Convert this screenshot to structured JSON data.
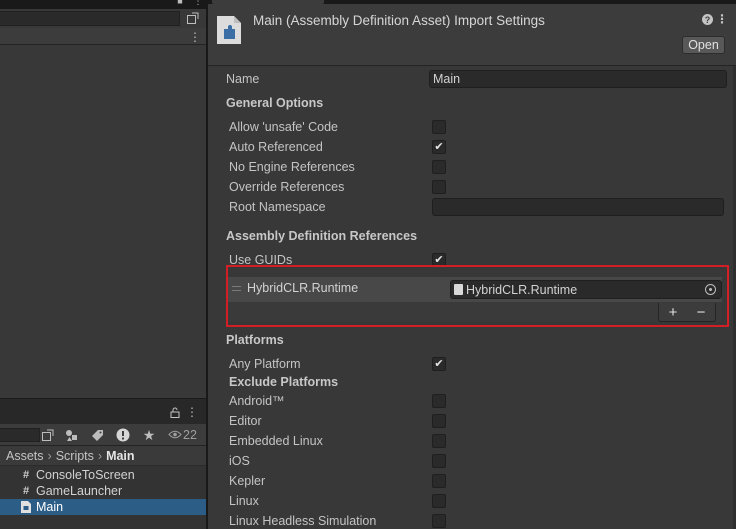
{
  "project": {
    "eye_count": "22",
    "breadcrumb": [
      "Assets",
      "Scripts",
      "Main"
    ],
    "files": [
      {
        "name": "ConsoleToScreen",
        "icon": "csharp-icon",
        "selected": false
      },
      {
        "name": "GameLauncher",
        "icon": "csharp-icon",
        "selected": false
      },
      {
        "name": "Main",
        "icon": "assembly-definition-icon",
        "selected": true
      }
    ]
  },
  "inspector": {
    "title": "Main (Assembly Definition Asset) Import Settings",
    "open_label": "Open",
    "name_label": "Name",
    "name_value": "Main",
    "general_options": {
      "heading": "General Options",
      "allow_unsafe_label": "Allow 'unsafe' Code",
      "allow_unsafe": false,
      "auto_referenced_label": "Auto Referenced",
      "auto_referenced": true,
      "no_engine_refs_label": "No Engine References",
      "no_engine_refs": false,
      "override_refs_label": "Override References",
      "override_refs": false,
      "root_namespace_label": "Root Namespace",
      "root_namespace_value": ""
    },
    "assembly_refs": {
      "heading": "Assembly Definition References",
      "use_guids_label": "Use GUIDs",
      "use_guids": true,
      "items": [
        {
          "label": "HybridCLR.Runtime",
          "value": "HybridCLR.Runtime"
        }
      ],
      "add_label": "+",
      "remove_label": "−"
    },
    "platforms": {
      "heading": "Platforms",
      "any_platform_label": "Any Platform",
      "any_platform": true,
      "exclude_heading": "Exclude Platforms",
      "items": [
        {
          "label": "Android™",
          "checked": false
        },
        {
          "label": "Editor",
          "checked": false
        },
        {
          "label": "Embedded Linux",
          "checked": false
        },
        {
          "label": "iOS",
          "checked": false
        },
        {
          "label": "Kepler",
          "checked": false
        },
        {
          "label": "Linux",
          "checked": false
        },
        {
          "label": "Linux Headless Simulation",
          "checked": false
        }
      ]
    }
  },
  "colors": {
    "highlight": "#d21e25",
    "selection": "#2c5d87"
  }
}
